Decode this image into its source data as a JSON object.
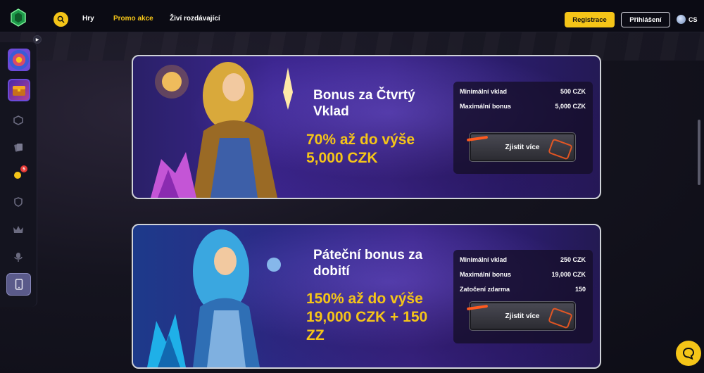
{
  "header": {
    "nav": [
      "Hry",
      "Promo akce",
      "Živí rozdávající"
    ],
    "active_nav_color": "#f5c518",
    "register_label": "Registrace",
    "login_label": "Přihlášení",
    "language": "CS"
  },
  "sidebar": {
    "items": [
      "wheel-thumbnail",
      "treasure-thumbnail",
      "dice-icon",
      "cards-icon",
      "coins-icon",
      "shield-icon",
      "crown-icon",
      "microphone-icon",
      "mobile-icon"
    ],
    "coins_badge": "5"
  },
  "promos": [
    {
      "title": "Bonus za Čtvrtý Vklad",
      "title_lines": [
        "Bonus za Čtvrtý",
        "Vklad"
      ],
      "amount_lines": [
        "70% až do výše",
        "5,000 CZK"
      ],
      "rows": [
        {
          "label": "Minimální vklad",
          "value": "500 CZK"
        },
        {
          "label": "Maximální bonus",
          "value": "5,000 CZK"
        }
      ],
      "cta": "Zjistit více"
    },
    {
      "title": "Páteční bonus za dobití",
      "title_lines": [
        "Páteční bonus za",
        "dobití"
      ],
      "amount_lines": [
        "150% až do výše",
        "19,000 CZK + 150",
        "ZZ"
      ],
      "rows": [
        {
          "label": "Minimální vklad",
          "value": "250 CZK"
        },
        {
          "label": "Maximální bonus",
          "value": "19,000 CZK"
        },
        {
          "label": "Zatočení zdarma",
          "value": "150"
        }
      ],
      "cta": "Zjistit více"
    }
  ],
  "colors": {
    "accent": "#f5c518",
    "header_bg": "#0b0b14",
    "card_border": "#cfd2d8"
  }
}
